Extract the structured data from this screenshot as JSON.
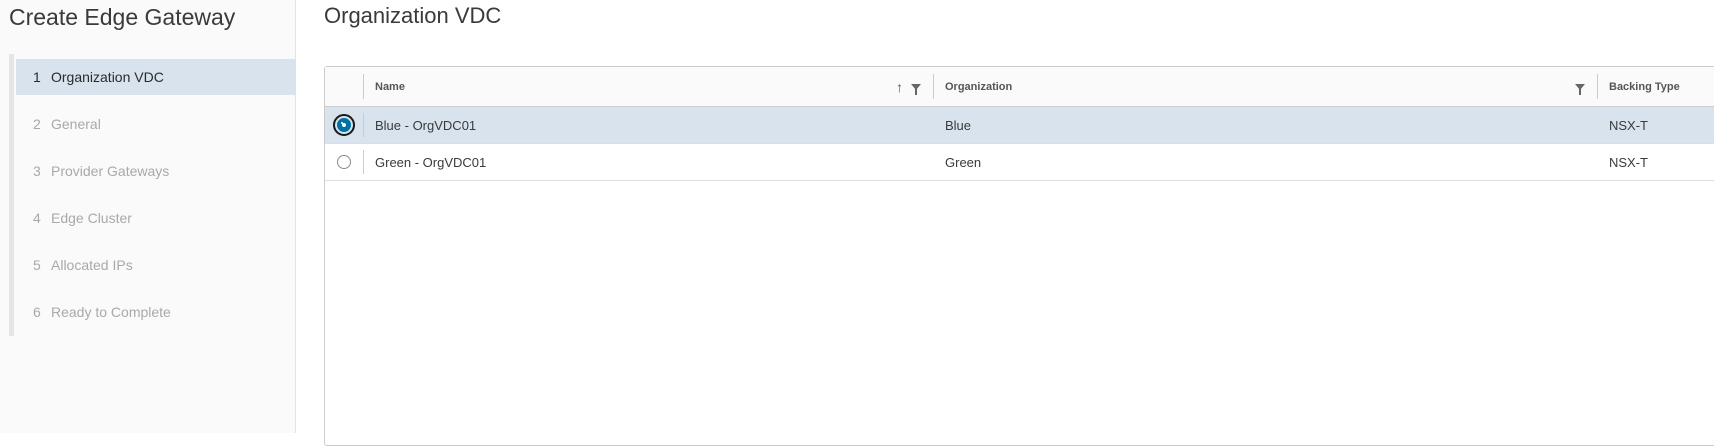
{
  "wizard": {
    "title": "Create Edge Gateway",
    "steps": [
      {
        "num": "1",
        "label": "Organization VDC",
        "active": true
      },
      {
        "num": "2",
        "label": "General",
        "active": false
      },
      {
        "num": "3",
        "label": "Provider Gateways",
        "active": false
      },
      {
        "num": "4",
        "label": "Edge Cluster",
        "active": false
      },
      {
        "num": "5",
        "label": "Allocated IPs",
        "active": false
      },
      {
        "num": "6",
        "label": "Ready to Complete",
        "active": false
      }
    ]
  },
  "main": {
    "title": "Organization VDC",
    "grid": {
      "columns": {
        "name": "Name",
        "organization": "Organization",
        "backing_type": "Backing Type"
      },
      "sort_icon": "arrow-up-icon",
      "filter_icon": "filter-icon",
      "rows": [
        {
          "name": "Blue - OrgVDC01",
          "organization": "Blue",
          "backing_type": "NSX-T",
          "selected": true
        },
        {
          "name": "Green - OrgVDC01",
          "organization": "Green",
          "backing_type": "NSX-T",
          "selected": false
        }
      ]
    }
  },
  "colors": {
    "accent": "#0072a3",
    "selected_row": "#d8e3ed"
  }
}
